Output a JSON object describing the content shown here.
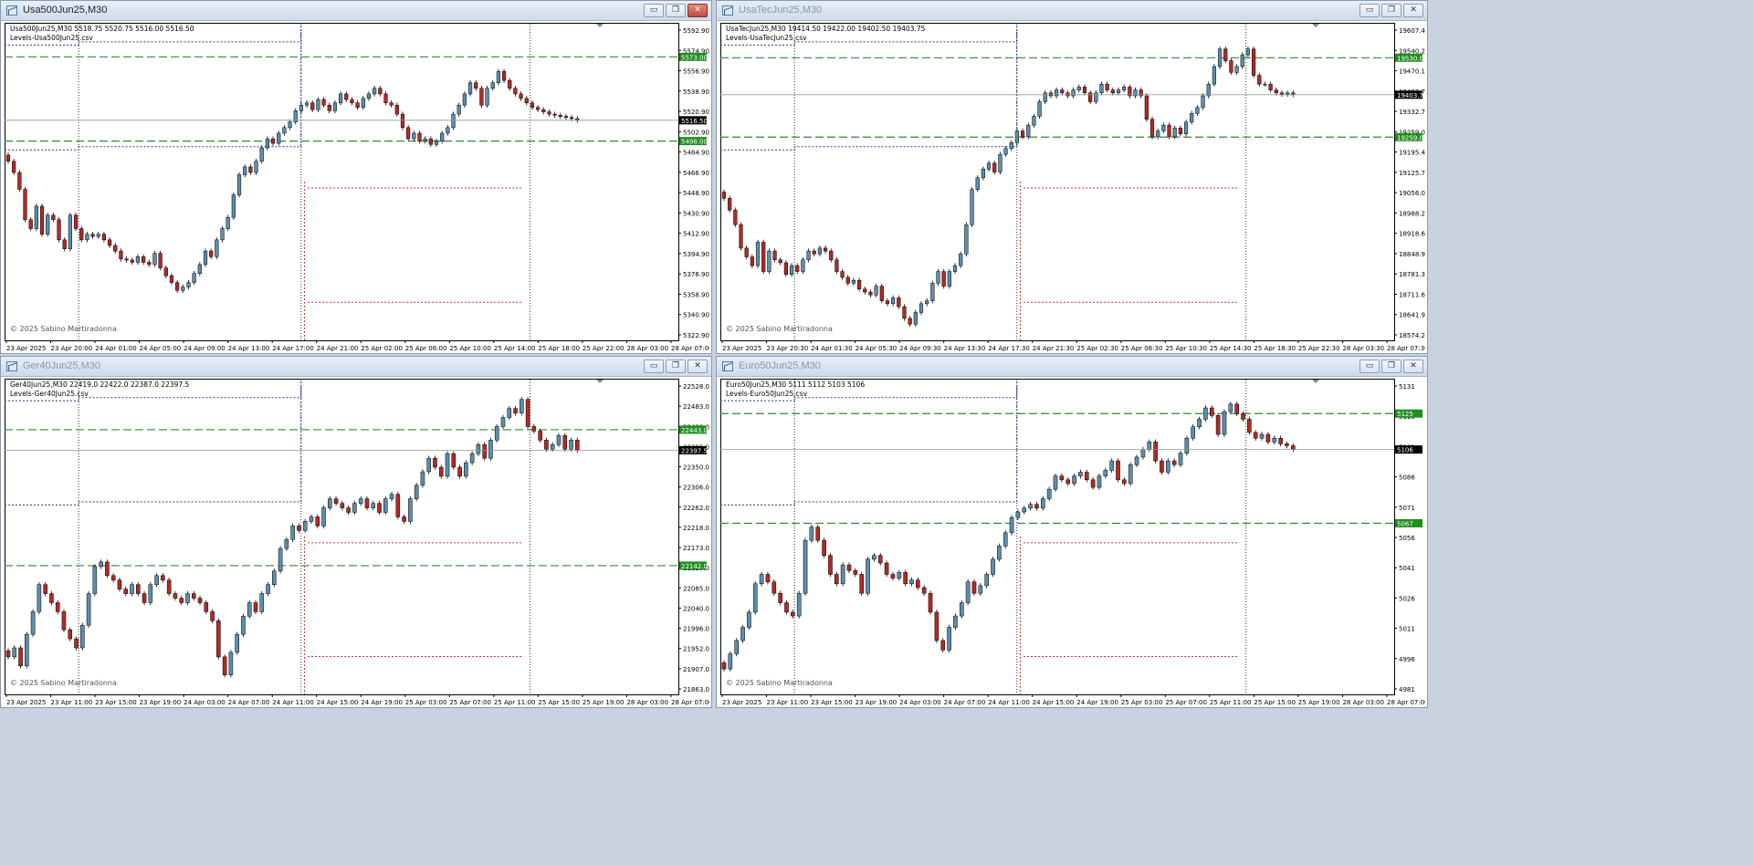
{
  "colors": {
    "bull": "#5b8fae",
    "bear": "#b22a24",
    "border": "#000000",
    "level": "#2e8b2e",
    "price_tag": "#000000",
    "level_tag": "#1f8f1f",
    "blue_line": "#2b3a8a",
    "red_line": "#c0392b",
    "grid_v": "#333333"
  },
  "window_controls": {
    "minimize": "▭",
    "restore": "❐",
    "close": "✕"
  },
  "charts": [
    {
      "title": "Usa500Jun25,M30",
      "info_line1": "Usa500Jun25,M30  5518.75 5520.75 5516.00 5516.50",
      "info_line2": "Levels-Usa500Jun25.csv",
      "copyright": "© 2025 Sabino Martiradonna",
      "y_ticks": [
        "5592.90",
        "5574.90",
        "5556.90",
        "5538.90",
        "5520.90",
        "5502.90",
        "5484.90",
        "5466.90",
        "5448.90",
        "5430.90",
        "5412.90",
        "5394.90",
        "5376.90",
        "5358.90",
        "5340.90",
        "5322.90"
      ],
      "x_ticks": [
        "23 Apr 2025",
        "23 Apr 20:00",
        "24 Apr 01:00",
        "24 Apr 05:00",
        "24 Apr 09:00",
        "24 Apr 13:00",
        "24 Apr 17:00",
        "24 Apr 21:00",
        "25 Apr 02:00",
        "25 Apr 06:00",
        "25 Apr 10:00",
        "25 Apr 14:00",
        "25 Apr 18:00",
        "25 Apr 22:00",
        "28 Apr 03:00",
        "28 Apr 07:00"
      ],
      "ylim": [
        5322.9,
        5600.9
      ],
      "price": 5516.5,
      "price_label": "5516.50",
      "levels": [
        {
          "value": 5573.0,
          "label": "5573.00"
        },
        {
          "value": 5498.0,
          "label": "5498.00"
        }
      ],
      "closes": [
        5480,
        5470,
        5455,
        5428,
        5420,
        5440,
        5415,
        5432,
        5428,
        5410,
        5402,
        5432,
        5420,
        5410,
        5415,
        5413,
        5415,
        5410,
        5405,
        5400,
        5393,
        5392,
        5390,
        5395,
        5390,
        5388,
        5398,
        5385,
        5378,
        5372,
        5365,
        5368,
        5372,
        5380,
        5388,
        5400,
        5395,
        5410,
        5420,
        5430,
        5450,
        5468,
        5475,
        5470,
        5480,
        5492,
        5500,
        5496,
        5505,
        5510,
        5515,
        5525,
        5530,
        5532,
        5526,
        5535,
        5530,
        5525,
        5532,
        5540,
        5535,
        5532,
        5528,
        5536,
        5540,
        5545,
        5540,
        5532,
        5530,
        5522,
        5510,
        5500,
        5505,
        5498,
        5500,
        5495,
        5498,
        5505,
        5510,
        5522,
        5530,
        5540,
        5550,
        5545,
        5530,
        5545,
        5550,
        5560,
        5552,
        5545,
        5540,
        5536,
        5532,
        5528,
        5526,
        5524,
        5522,
        5521,
        5520,
        5519,
        5518,
        5516.5
      ]
    },
    {
      "title": "UsaTecJun25,M30",
      "info_line1": "UsaTecJun25,M30  19414.50 19422.00 19402.50 19403.75",
      "info_line2": "Levels-UsaTecJun25.csv",
      "copyright": "© 2025 Sabino Martiradonna",
      "y_ticks": [
        "19607.45",
        "19540.20",
        "19470.10",
        "19403.75",
        "19332.75",
        "19259.00",
        "19195.45",
        "19125.70",
        "19056.00",
        "18988.25",
        "18918.65",
        "18848.95",
        "18781.30",
        "18711.60",
        "18641.95",
        "18574.25"
      ],
      "x_ticks": [
        "23 Apr 2025",
        "23 Apr 20:30",
        "24 Apr 01:30",
        "24 Apr 05:30",
        "24 Apr 09:30",
        "24 Apr 13:30",
        "24 Apr 17:30",
        "24 Apr 21:30",
        "25 Apr 02:30",
        "25 Apr 06:30",
        "25 Apr 10:30",
        "25 Apr 14:30",
        "25 Apr 18:30",
        "25 Apr 22:30",
        "28 Apr 03:30",
        "28 Apr 07:30"
      ],
      "ylim": [
        18574.25,
        19640
      ],
      "price": 19403.75,
      "price_label": "19403.75",
      "levels": [
        {
          "value": 19530.0,
          "label": "19530.00"
        },
        {
          "value": 19259.0,
          "label": "19259.00"
        }
      ],
      "closes": [
        19050,
        19010,
        18960,
        18880,
        18850,
        18820,
        18900,
        18800,
        18870,
        18840,
        18830,
        18790,
        18820,
        18800,
        18840,
        18870,
        18860,
        18880,
        18870,
        18840,
        18800,
        18780,
        18760,
        18770,
        18740,
        18730,
        18720,
        18750,
        18700,
        18690,
        18710,
        18680,
        18640,
        18620,
        18660,
        18690,
        18700,
        18760,
        18800,
        18750,
        18800,
        18820,
        18860,
        18960,
        19080,
        19120,
        19150,
        19170,
        19140,
        19200,
        19220,
        19240,
        19280,
        19260,
        19300,
        19330,
        19380,
        19410,
        19400,
        19420,
        19410,
        19400,
        19420,
        19430,
        19410,
        19380,
        19410,
        19440,
        19420,
        19410,
        19420,
        19430,
        19400,
        19420,
        19400,
        19320,
        19260,
        19280,
        19300,
        19260,
        19290,
        19270,
        19310,
        19340,
        19360,
        19400,
        19440,
        19500,
        19560,
        19520,
        19480,
        19500,
        19540,
        19560,
        19470,
        19440,
        19440,
        19420,
        19410,
        19405,
        19410,
        19403.75
      ]
    },
    {
      "title": "Ger40Jun25,M30",
      "info_line1": "Ger40Jun25,M30  22419.0 22422.0 22387.0 22397.5",
      "info_line2": "Levels-Ger40Jun25.csv",
      "copyright": "© 2025 Sabino Martiradonna",
      "y_ticks": [
        "22528.0",
        "22483.0",
        "22439.0",
        "22395.0",
        "22350.0",
        "22306.0",
        "22262.0",
        "22218.0",
        "22173.0",
        "22129.0",
        "22085.0",
        "22040.0",
        "21996.0",
        "21952.0",
        "21907.0",
        "21863.0"
      ],
      "x_ticks": [
        "23 Apr 2025",
        "23 Apr 11:00",
        "23 Apr 15:00",
        "23 Apr 19:00",
        "24 Apr 03:00",
        "24 Apr 07:00",
        "24 Apr 11:00",
        "24 Apr 15:00",
        "24 Apr 19:00",
        "25 Apr 03:00",
        "25 Apr 07:00",
        "25 Apr 11:00",
        "25 Apr 15:00",
        "25 Apr 19:00",
        "28 Apr 03:00",
        "28 Apr 07:00"
      ],
      "ylim": [
        21863,
        22550
      ],
      "price": 22397.5,
      "price_label": "22397.5",
      "levels": [
        {
          "value": 22443.0,
          "label": "22443.0"
        },
        {
          "value": 22142.0,
          "label": "22142.0"
        }
      ],
      "closes": [
        21940,
        21960,
        21920,
        21990,
        22040,
        22100,
        22080,
        22060,
        22040,
        22000,
        21980,
        21960,
        22010,
        22080,
        22140,
        22150,
        22120,
        22110,
        22090,
        22080,
        22100,
        22080,
        22060,
        22100,
        22120,
        22110,
        22080,
        22070,
        22060,
        22080,
        22070,
        22060,
        22040,
        22020,
        21940,
        21900,
        21950,
        21990,
        22030,
        22060,
        22040,
        22080,
        22100,
        22130,
        22180,
        22200,
        22230,
        22220,
        22240,
        22250,
        22230,
        22270,
        22290,
        22280,
        22270,
        22260,
        22280,
        22290,
        22270,
        22280,
        22260,
        22290,
        22300,
        22250,
        22240,
        22290,
        22320,
        22350,
        22380,
        22360,
        22340,
        22390,
        22360,
        22340,
        22370,
        22390,
        22410,
        22380,
        22420,
        22450,
        22470,
        22490,
        22480,
        22510,
        22450,
        22440,
        22420,
        22400,
        22410,
        22430,
        22400,
        22420,
        22397.5
      ]
    },
    {
      "title": "Euro50Jun25,M30",
      "info_line1": "Euro50Jun25,M30  5111 5112 5103 5106",
      "info_line2": "Levels-Euro50Jun25.csv",
      "copyright": "© 2025 Sabino Martiradonna",
      "y_ticks": [
        "5131",
        "5116",
        "5101",
        "5086",
        "5071",
        "5056",
        "5041",
        "5026",
        "5011",
        "4996",
        "4981"
      ],
      "x_ticks": [
        "23 Apr 2025",
        "23 Apr 11:00",
        "23 Apr 15:00",
        "23 Apr 19:00",
        "24 Apr 03:00",
        "24 Apr 07:00",
        "24 Apr 11:00",
        "24 Apr 15:00",
        "24 Apr 19:00",
        "25 Apr 03:00",
        "25 Apr 07:00",
        "25 Apr 11:00",
        "25 Apr 15:00",
        "25 Apr 19:00",
        "28 Apr 03:00",
        "28 Apr 07:00"
      ],
      "ylim": [
        4978,
        5142
      ],
      "price": 5106,
      "price_label": "5106",
      "levels": [
        {
          "value": 5125,
          "label": "5125"
        },
        {
          "value": 5067,
          "label": "5067"
        }
      ],
      "closes": [
        4990,
        4998,
        5005,
        5012,
        5020,
        5035,
        5040,
        5036,
        5030,
        5025,
        5020,
        5018,
        5030,
        5058,
        5065,
        5058,
        5050,
        5040,
        5035,
        5045,
        5042,
        5040,
        5030,
        5048,
        5050,
        5046,
        5040,
        5038,
        5041,
        5035,
        5037,
        5033,
        5030,
        5020,
        5005,
        5000,
        5012,
        5018,
        5025,
        5036,
        5030,
        5034,
        5040,
        5048,
        5055,
        5062,
        5070,
        5073,
        5075,
        5077,
        5075,
        5080,
        5085,
        5092,
        5090,
        5088,
        5092,
        5094,
        5090,
        5086,
        5092,
        5095,
        5100,
        5090,
        5088,
        5098,
        5102,
        5106,
        5110,
        5100,
        5094,
        5100,
        5098,
        5104,
        5112,
        5118,
        5122,
        5128,
        5124,
        5114,
        5126,
        5130,
        5125,
        5122,
        5115,
        5112,
        5114,
        5110,
        5112,
        5109,
        5108,
        5106
      ]
    }
  ]
}
